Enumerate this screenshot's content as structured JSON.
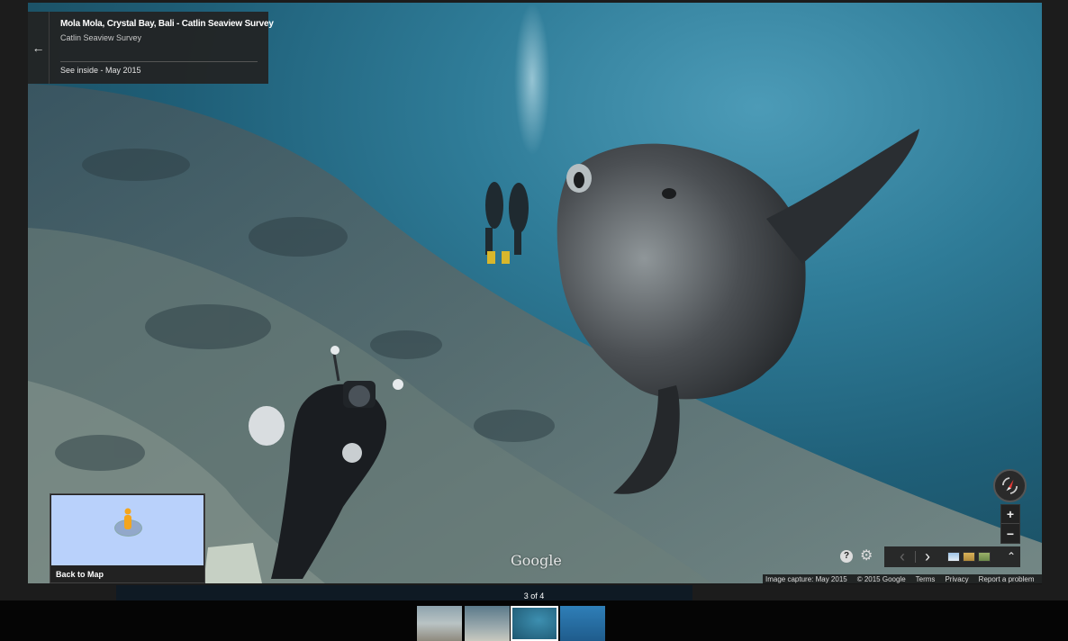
{
  "info_card": {
    "title": "Mola Mola, Crystal Bay, Bali - Catlin Seaview Survey",
    "subtitle": "Catlin Seaview Survey",
    "date": "See inside - May 2015",
    "back_icon": "arrow-left-icon"
  },
  "minimap": {
    "label": "Back to Map",
    "icon": "pegman-icon"
  },
  "logo": "Google",
  "controls": {
    "zoom_in": "+",
    "zoom_out": "−",
    "help": "?",
    "settings": "⚙",
    "prev": "‹",
    "next": "›",
    "expand": "⌃"
  },
  "footer": {
    "capture": "Image capture: May 2015",
    "copyright": "© 2015 Google",
    "terms": "Terms",
    "privacy": "Privacy",
    "report": "Report a problem"
  },
  "filmstrip": {
    "counter": "3 of 4",
    "active_index": 2,
    "thumbnails": [
      "photo-1",
      "photo-2",
      "photo-3",
      "photo-4"
    ]
  },
  "colors": {
    "water": "#2f7c98",
    "panel": "#222222",
    "minimap": "#b9d1fb",
    "pegman": "#f4a51c"
  }
}
